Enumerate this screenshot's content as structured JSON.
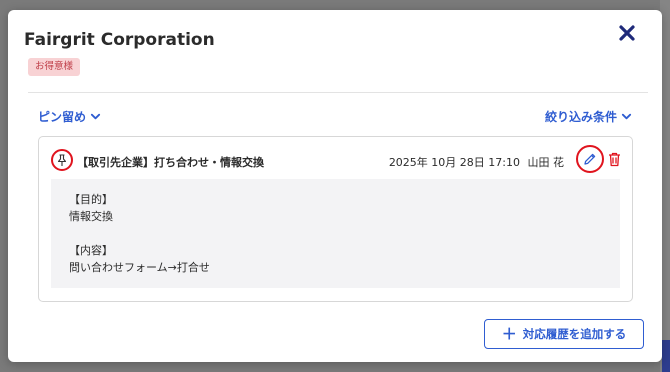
{
  "modal": {
    "title": "Fairgrit Corporation",
    "badge": "お得意様",
    "pin_toggle_label": "ピン留め",
    "filter_toggle_label": "絞り込み条件"
  },
  "record": {
    "title": "【取引先企業】打ち合わせ・情報交換",
    "datetime": "2025年 10月 28日 17:10",
    "author": "山田 花",
    "purpose_heading": "【目的】",
    "purpose_text": "情報交換",
    "content_heading": "【内容】",
    "content_text": "問い合わせフォーム→打合せ"
  },
  "actions": {
    "add_history_label": "対応履歴を追加する"
  },
  "colors": {
    "accent": "#2f5dd1",
    "close": "#1f2a7a",
    "highlight": "#e0141e",
    "badge_bg": "#f8d2d4",
    "badge_text": "#c0404a"
  },
  "icons": [
    "close-icon",
    "chevron-down-icon",
    "pin-icon",
    "pencil-icon",
    "trash-icon",
    "plus-icon"
  ]
}
